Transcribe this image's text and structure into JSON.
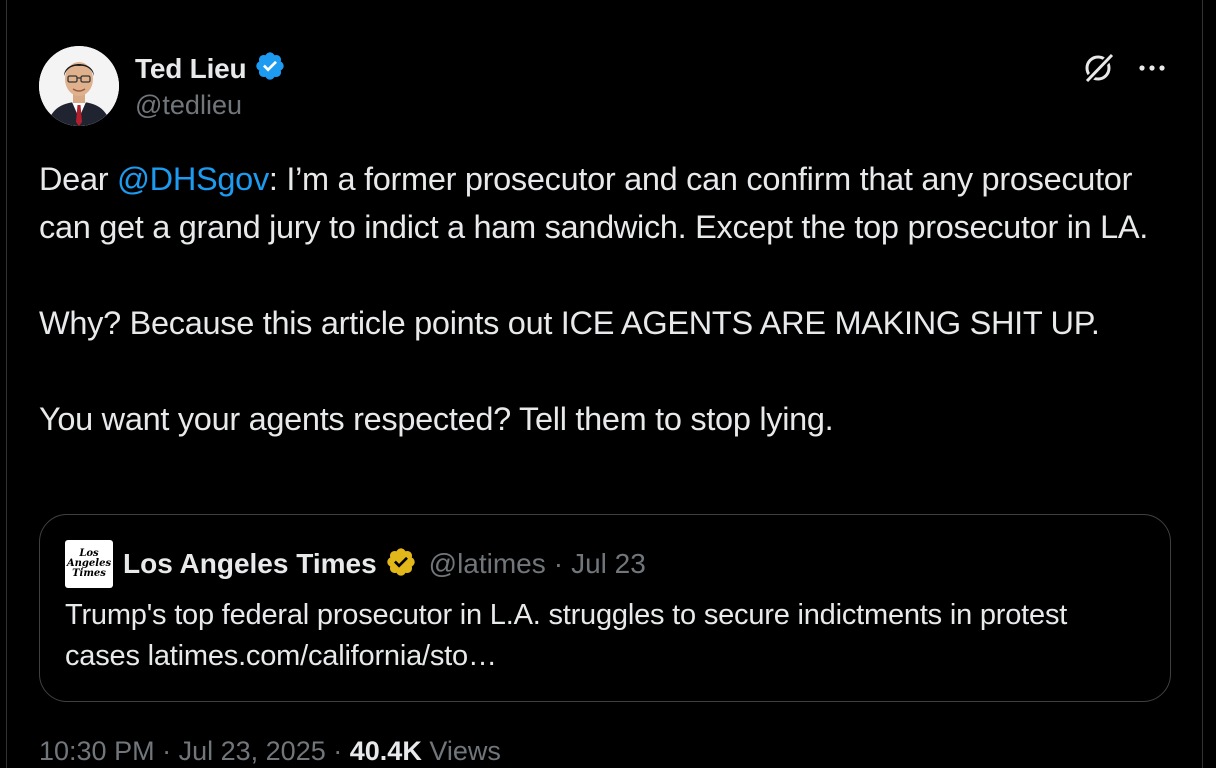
{
  "author": {
    "name": "Ted Lieu",
    "handle": "@tedlieu",
    "verified": true,
    "verified_color": "#1d9bf0"
  },
  "actions": {
    "grok_icon": "grok-icon",
    "more_icon": "more-icon"
  },
  "tweet": {
    "prefix": "Dear ",
    "mention": "@DHSgov",
    "paragraph1_rest": ": I’m a former prosecutor and can confirm that any prosecutor can get a grand jury to indict a ham sandwich. Except the top prosecutor in LA.",
    "paragraph2": "Why? Because this article points out ICE AGENTS ARE MAKING SHIT UP.",
    "paragraph3": "You want your agents respected? Tell them to stop lying."
  },
  "quote": {
    "logo_text": [
      "Los",
      "Angeles",
      "Times"
    ],
    "name": "Los Angeles Times",
    "verified_color": "#e2b719",
    "handle": "@latimes",
    "separator": "·",
    "date": "Jul 23",
    "text": "Trump's top federal prosecutor in L.A. struggles to secure indictments in protest cases latimes.com/california/sto…"
  },
  "meta": {
    "time": "10:30 PM",
    "separator": "·",
    "date": "Jul 23, 2025",
    "views_count": "40.4K",
    "views_label": "Views"
  },
  "colors": {
    "background": "#000000",
    "text": "#e7e9ea",
    "muted": "#71767b",
    "accent": "#1d9bf0"
  }
}
